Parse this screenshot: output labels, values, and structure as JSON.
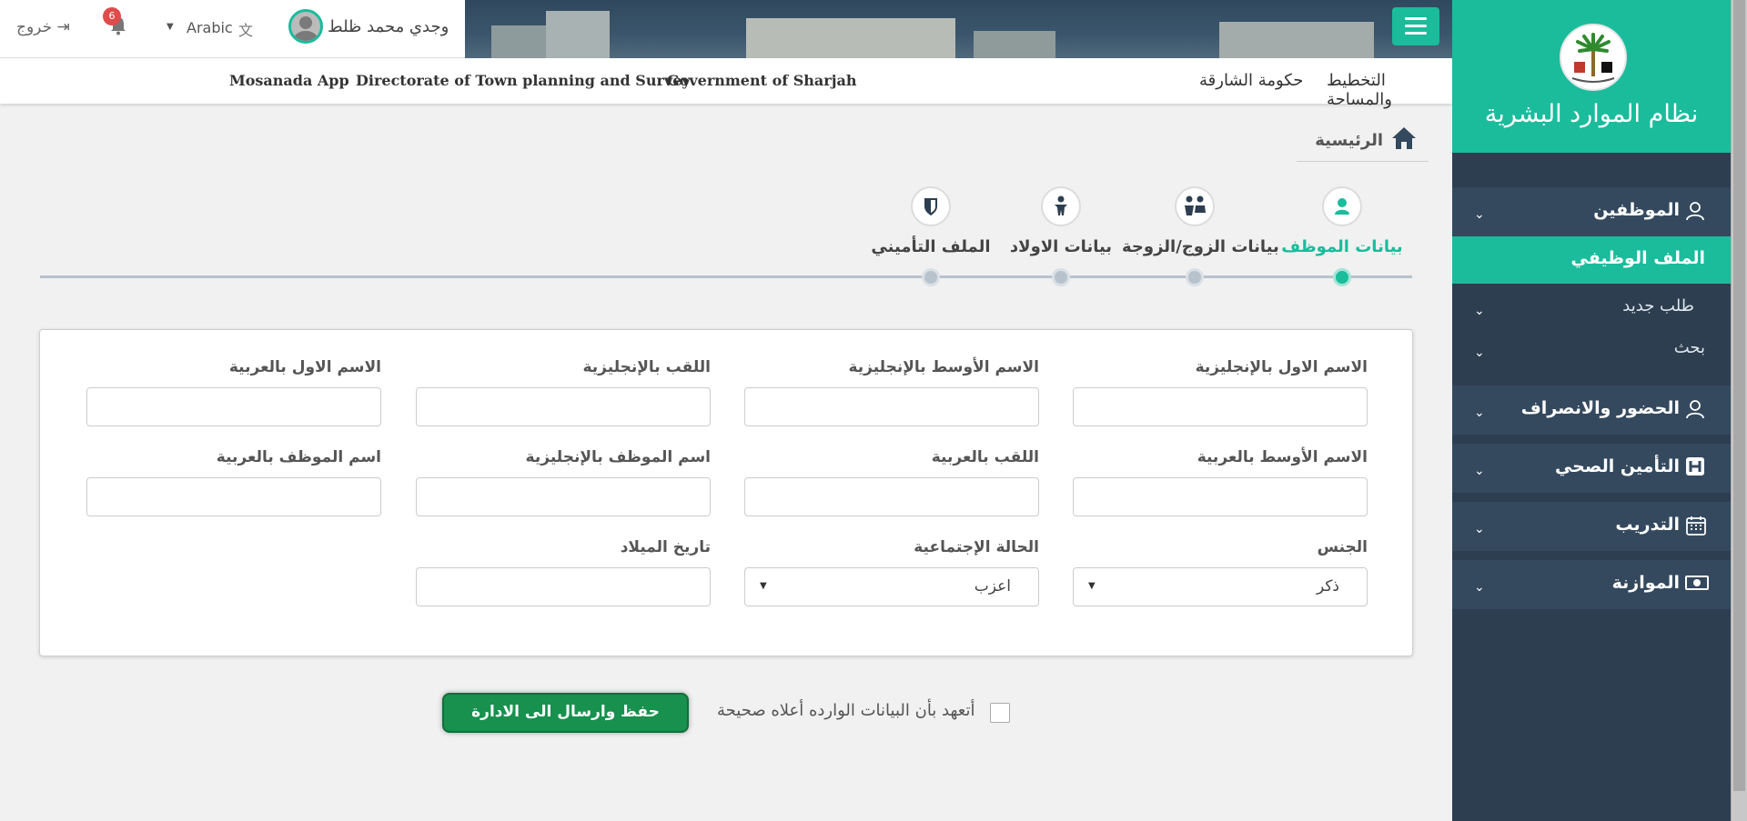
{
  "sidebar": {
    "title": "نظام الموارد البشرية",
    "groups": [
      {
        "label": "الموظفين",
        "icon": "user-outline-icon"
      },
      {
        "label": "الحضور والانصراف",
        "icon": "user-outline-icon"
      },
      {
        "label": "التأمين الصحي",
        "icon": "hospital-icon"
      },
      {
        "label": "التدريب",
        "icon": "calendar-icon"
      },
      {
        "label": "الموازنة",
        "icon": "money-icon"
      }
    ],
    "sub_active": "الملف الوظيفي",
    "sub_items": [
      "طلب جديد",
      "بحث"
    ]
  },
  "header": {
    "user_name": "وجدي محمد ظلط",
    "language": "Arabic",
    "notifications_count": "6",
    "logout": "خروج"
  },
  "subheader": {
    "en_items": [
      "Mosanada App",
      "Directorate of Town planning and Survey",
      "Government of Sharjah"
    ],
    "ar_items": [
      "حكومة الشارقة",
      "التخطيط والمساحة"
    ]
  },
  "breadcrumb": {
    "home_label": "الرئيسية"
  },
  "steps": [
    {
      "label": "بيانات الموظف",
      "icon": "person-icon",
      "active": true
    },
    {
      "label": "بيانات الزوج/الزوجة",
      "icon": "couple-icon",
      "active": false
    },
    {
      "label": "بيانات الاولاد",
      "icon": "child-icon",
      "active": false
    },
    {
      "label": "الملف التأميني",
      "icon": "shield-icon",
      "active": false
    }
  ],
  "form": {
    "first_name_en": "الاسم الاول بالإنجليزية",
    "middle_name_en": "الاسم الأوسط بالإنجليزية",
    "surname_en": "اللقب بالإنجليزية",
    "first_name_ar": "الاسم الاول بالعربية",
    "middle_name_ar": "الاسم الأوسط بالعربية",
    "surname_ar": "اللقب بالعربية",
    "employee_name_en": "اسم الموظف بالإنجليزية",
    "employee_name_ar": "اسم الموظف بالعربية",
    "gender_label": "الجنس",
    "gender_value": "ذكر",
    "marital_label": "الحالة الإجتماعية",
    "marital_value": "اعزب",
    "birth_date_label": "تاريخ الميلاد"
  },
  "footer": {
    "pledge": "أتعهد بأن البيانات الوارده أعلاه صحيحة",
    "submit": "حفظ وارسال الى الادارة"
  },
  "colors": {
    "accent": "#1abc9c",
    "sidebar": "#2d3e50",
    "submit": "#17914d"
  }
}
